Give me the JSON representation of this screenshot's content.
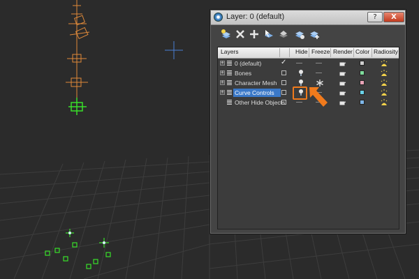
{
  "window": {
    "title": "Layer: 0 (default)",
    "help_label": "?",
    "close_label": "X"
  },
  "toolbar": {
    "tools": [
      {
        "icon": "create-layer-icon"
      },
      {
        "icon": "delete-layer-icon"
      },
      {
        "icon": "add-to-layer-icon"
      },
      {
        "icon": "select-in-layer-icon"
      },
      {
        "icon": "highlight-selected-icon"
      },
      {
        "icon": "hide-all-icon"
      },
      {
        "icon": "freeze-all-icon"
      }
    ]
  },
  "columns": {
    "layers": "Layers",
    "hide": "Hide",
    "freeze": "Freeze",
    "render": "Render",
    "color": "Color",
    "radiosity": "Radiosity"
  },
  "layers": [
    {
      "name": "0 (default)",
      "active": true,
      "hide": "off",
      "freeze": "off",
      "color": "#cfcfcf"
    },
    {
      "name": "Bones",
      "active": false,
      "hide": "on",
      "freeze": "off",
      "color": "#7fdc9c"
    },
    {
      "name": "Character Mesh",
      "active": false,
      "hide": "on",
      "freeze": "on",
      "color": "#e8a4b8"
    },
    {
      "name": "Curve Controls",
      "active": false,
      "selected": true,
      "hide": "on",
      "freeze": "off",
      "color": "#6ad2e8"
    },
    {
      "name": "Other Hide Objects",
      "active": false,
      "hide": "off",
      "freeze": "off",
      "color": "#7fb7e8"
    }
  ],
  "colors": {
    "accent_selection": "#3a78c8",
    "annotation_orange": "#f07a1c",
    "bone_orange": "#e08a3a",
    "control_green": "#39e02a"
  }
}
